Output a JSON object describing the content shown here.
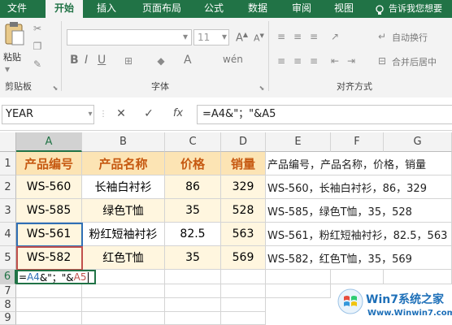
{
  "ribbon": {
    "tabs": [
      "文件",
      "开始",
      "插入",
      "页面布局",
      "公式",
      "数据",
      "审阅",
      "视图"
    ],
    "active_tab": "开始",
    "tell_me": "告诉我您想要",
    "paste_label": "粘贴",
    "clipboard_label": "剪贴板",
    "font_size": "11",
    "font_group_label": "字体",
    "wrap_text_label": "自动换行",
    "merge_center_label": "合并后居中",
    "alignment_group_label": "对齐方式"
  },
  "formula_bar": {
    "name_box": "YEAR",
    "cancel_icon": "✕",
    "enter_icon": "✓",
    "fx_icon": "fx",
    "formula": "=A4&\"；\"&A5"
  },
  "sheet": {
    "columns": [
      "A",
      "B",
      "C",
      "D",
      "E",
      "F",
      "G"
    ],
    "rows": [
      "1",
      "2",
      "3",
      "4",
      "5",
      "6",
      "7",
      "8",
      "9"
    ],
    "header": [
      "产品编号",
      "产品名称",
      "价格",
      "销量"
    ],
    "data": [
      [
        "WS-560",
        "长袖白衬衫",
        "86",
        "329"
      ],
      [
        "WS-585",
        "绿色T恤",
        "35",
        "528"
      ],
      [
        "WS-561",
        "粉红短袖衬衫",
        "82.5",
        "563"
      ],
      [
        "WS-582",
        "红色T恤",
        "35",
        "569"
      ]
    ],
    "e_column": [
      "产品编号，产品名称，价格，销量",
      "WS-560，长袖白衬衫，86，329",
      "WS-585，绿色T恤，35，528",
      "WS-561，粉红短袖衬衫，82.5，563",
      "WS-582，红色T恤，35，569"
    ],
    "edit_cell": {
      "prefix": "=",
      "ref1": "A4",
      "middle": "&\"；\"&",
      "ref2": "A5"
    }
  },
  "watermark": {
    "brand": "Win7系统之家",
    "url": "Www.Winwin7.com"
  },
  "colors": {
    "excel_green": "#217346",
    "header_fill": "#fce4b4",
    "header_text": "#c65911",
    "data_fill": "#fff6df",
    "ref1_color": "#2f6fb5",
    "ref2_color": "#c0504d"
  }
}
